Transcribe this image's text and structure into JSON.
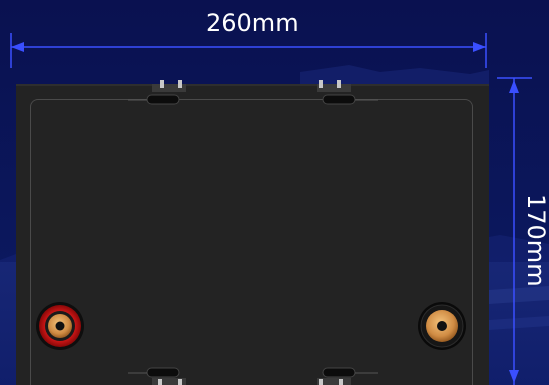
{
  "dimensions": {
    "width_label": "260mm",
    "height_label": "170mm"
  },
  "colors": {
    "background": "#0a1352",
    "dimension_line": "#3a4fff",
    "battery_body": "#232323",
    "positive_terminal": "#d01414",
    "negative_terminal": "#141414",
    "terminal_brass": "#d89a52"
  },
  "terminals": {
    "positive": "positive-terminal",
    "negative": "negative-terminal"
  }
}
